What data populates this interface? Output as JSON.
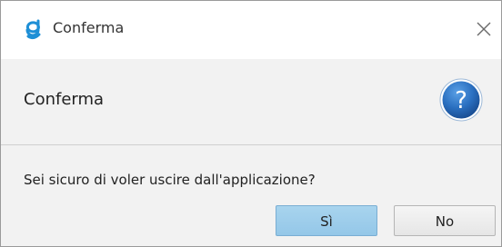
{
  "window": {
    "title": "Conferma",
    "logo_icon": "app-g-logo-icon",
    "close_icon": "close-icon"
  },
  "header": {
    "text": "Conferma",
    "icon": "question-icon",
    "icon_color": "#2a6fc0"
  },
  "message": "Sei sicuro di voler uscire dall'applicazione?",
  "buttons": {
    "yes_label": "Sì",
    "no_label": "No"
  },
  "colors": {
    "accent": "#1e8fd6",
    "yes_button": "#a8d4ee"
  }
}
